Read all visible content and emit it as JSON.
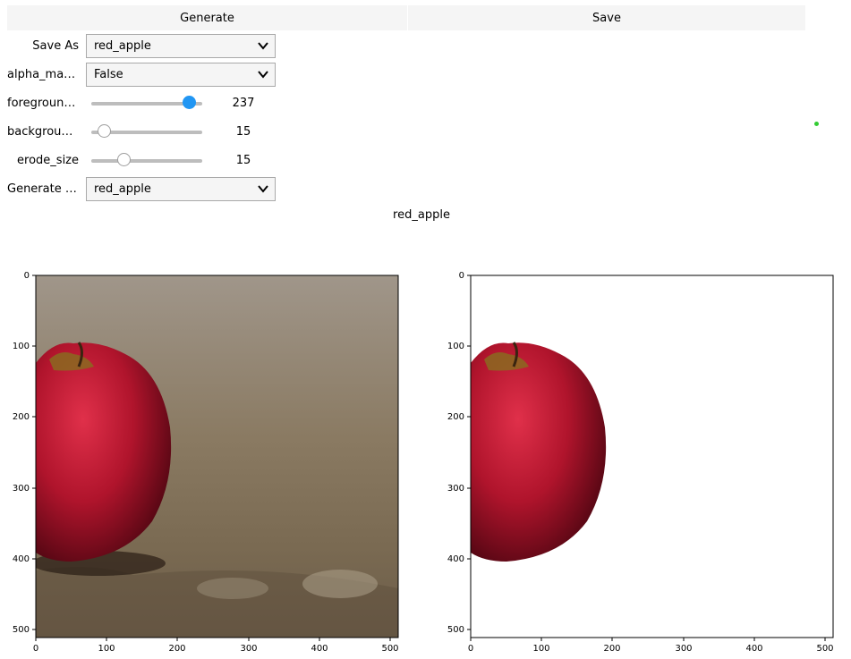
{
  "buttons": {
    "generate": "Generate",
    "save": "Save"
  },
  "controls": {
    "save_as": {
      "label": "Save As",
      "value": "red_apple"
    },
    "alpha_matting": {
      "label": "alpha_matt...",
      "value": "False"
    },
    "foreground": {
      "label": "foreground...",
      "value": "237",
      "max": 255,
      "accent": "#2196f3"
    },
    "background": {
      "label": "backgroun...",
      "value": "15",
      "max": 255
    },
    "erode_size": {
      "label": "erode_size",
      "value": "15",
      "max": 255
    },
    "generate_c": {
      "label": "Generate c...",
      "value": "red_apple"
    }
  },
  "status_dot_color": "#33cc33",
  "caption": "red_apple",
  "plots": {
    "ticks_x": [
      "0",
      "100",
      "200",
      "300",
      "400",
      "500"
    ],
    "ticks_y": [
      "0",
      "100",
      "200",
      "300",
      "400",
      "500"
    ],
    "range": [
      0,
      512
    ]
  }
}
